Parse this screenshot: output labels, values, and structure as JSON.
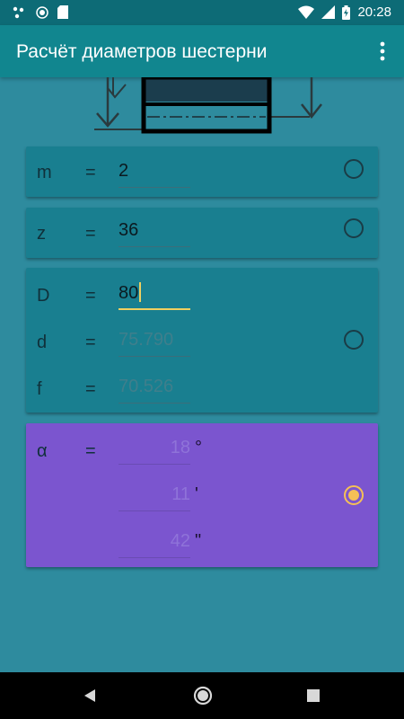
{
  "status_bar": {
    "time": "20:28",
    "icons": [
      "dots-icon",
      "circle-icon",
      "sd-card-icon",
      "wifi-icon",
      "signal-icon",
      "battery-icon"
    ]
  },
  "app_bar": {
    "title": "Расчёт диаметров шестерни",
    "menu_icon": "more-vert-icon"
  },
  "cards": {
    "module": {
      "label": "m",
      "eq": "=",
      "value": "2",
      "selected": false
    },
    "teeth": {
      "label": "z",
      "eq": "=",
      "value": "36",
      "selected": false
    },
    "diameters": {
      "D": {
        "label": "D",
        "eq": "=",
        "value": "80"
      },
      "d": {
        "label": "d",
        "eq": "=",
        "value": "75.790"
      },
      "f": {
        "label": "f",
        "eq": "=",
        "value": "70.526"
      },
      "selected": false
    },
    "angle": {
      "label": "α",
      "eq": "=",
      "degrees": "18",
      "degrees_unit": "°",
      "minutes": "11",
      "minutes_unit": "'",
      "seconds": "42",
      "seconds_unit": "\"",
      "selected": true
    }
  },
  "colors": {
    "background": "#2e8b9e",
    "app_bar": "#11868f",
    "card": "#197f90",
    "selected_card": "#7b55cf",
    "accent": "#f5c056"
  },
  "nav_bar": {
    "back_icon": "back-icon",
    "home_icon": "home-icon",
    "recents_icon": "recents-icon"
  }
}
